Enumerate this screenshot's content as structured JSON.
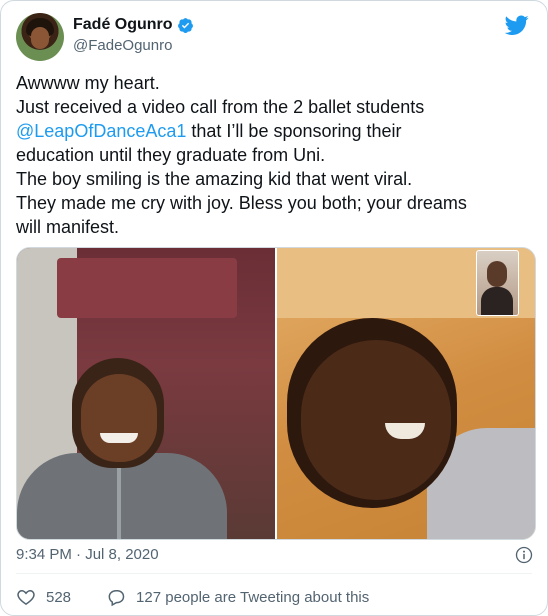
{
  "author": {
    "display_name": "Fadé Ogunro",
    "handle": "@FadeOgunro",
    "verified_icon": "verified-badge-icon",
    "brand_icon": "twitter-bird-icon"
  },
  "tweet": {
    "lines": [
      "Awwww my heart.",
      "Just received a video call from the 2 ballet students",
      "that I’ll be sponsoring their",
      "education until they graduate from Uni.",
      "The boy smiling is the amazing kid that went viral.",
      "They made me cry with joy. Bless you both; your dreams",
      "will manifest."
    ],
    "mention": "@LeapOfDanceAca1"
  },
  "timestamp": "9:34 PM · Jul 8, 2020",
  "actions": {
    "like_count": "528",
    "conversation_text": "127 people are Tweeting about this"
  },
  "colors": {
    "accent": "#1d9bf0",
    "like": "#f91880",
    "secondary_text": "#536471"
  }
}
